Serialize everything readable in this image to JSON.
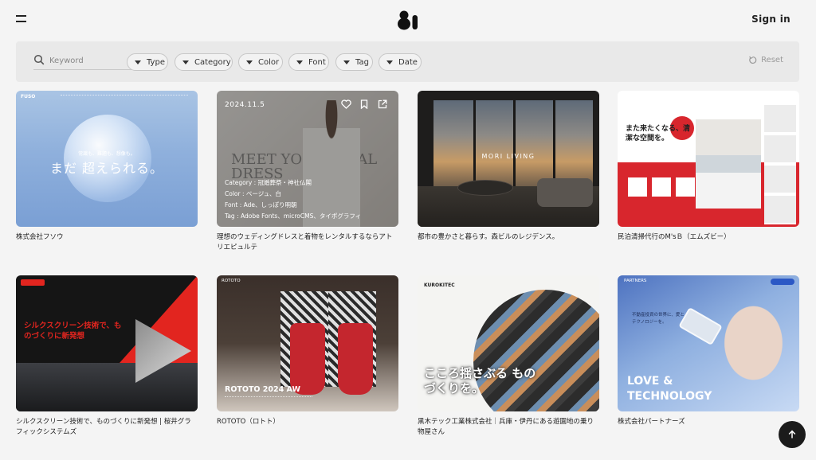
{
  "header": {
    "signin_label": "Sign in"
  },
  "filters": {
    "search_placeholder": "Keyword",
    "chips": [
      "Type",
      "Category",
      "Color",
      "Font",
      "Tag",
      "Date"
    ],
    "reset_label": "Reset"
  },
  "cards": [
    {
      "caption": "株式会社フソウ",
      "thumb": {
        "brand": "FUSO",
        "small": "常識も、難題も、想像も。",
        "headline": "まだ 超えられる。"
      }
    },
    {
      "caption": "理想のウェディングドレスと着物をレンタルするならアトリエピュルテ",
      "thumb": {
        "date": "2024.11.5",
        "bg_text": "MEET YOUR IDEAL DRESS",
        "category": "Category : 冠婚葬祭・神社仏閣",
        "color": "Color : ベージュ、白",
        "font": "Font : Ade、しっぽり明朝",
        "tag": "Tag : Adobe Fonts、microCMS、タイポグラフィ"
      }
    },
    {
      "caption": "都市の豊かさと暮らす。森ビルのレジデンス。",
      "thumb": {
        "title": "MORI LIVING"
      }
    },
    {
      "caption": "民泊清掃代行のM'sＢ（エムズビー）",
      "thumb": {
        "headline": "また来たくなる、清潔な空間を。"
      }
    },
    {
      "caption": "シルクスクリーン技術で、ものづくりに新発想 | 桜井グラフィックシステムズ",
      "thumb": {
        "headline": "シルクスクリーン技術で、ものづくりに新発想"
      }
    },
    {
      "caption": "ROTOTO（ロトト）",
      "thumb": {
        "brand": "ROTOTO",
        "title": "ROTOTO 2024 AW"
      }
    },
    {
      "caption": "黒木テック工業株式会社｜兵庫・伊丹にある遊園地の乗り物屋さん",
      "thumb": {
        "brand": "KUROKITEC",
        "headline": "こころ揺さぶる ものづくりを。"
      }
    },
    {
      "caption": "株式会社パートナーズ",
      "thumb": {
        "brand": "PARTNERS",
        "small": "不動産投資の世界に、愛とテクノロジーを。",
        "line1": "LOVE &",
        "line2": "TECHNOLOGY"
      }
    }
  ]
}
